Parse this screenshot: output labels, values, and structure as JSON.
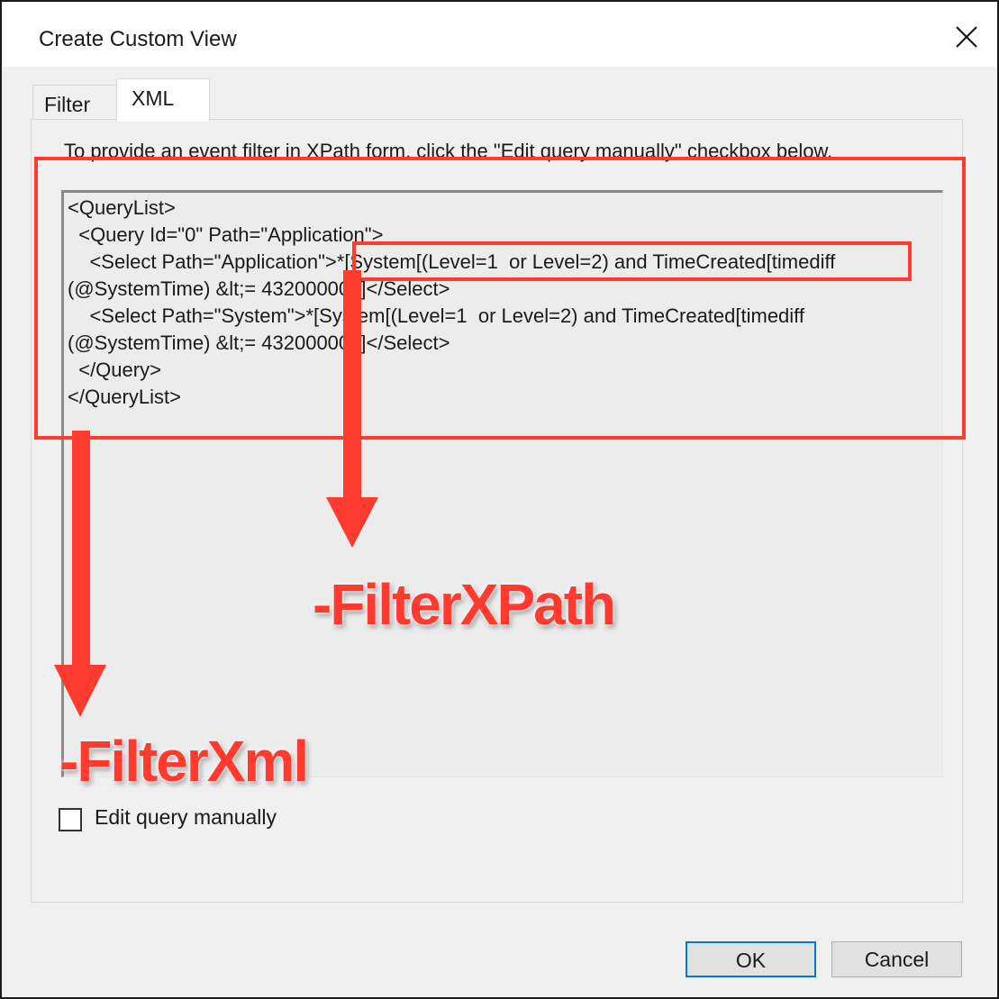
{
  "window": {
    "title": "Create Custom View",
    "close_icon": "close-icon"
  },
  "tabs": [
    {
      "label": "Filter",
      "selected": false
    },
    {
      "label": "XML",
      "selected": true
    }
  ],
  "xml_tab": {
    "hint": "To provide an event filter in XPath form, click the \"Edit query manually\" checkbox below.",
    "lines": [
      "<QueryList>",
      "  <Query Id=\"0\" Path=\"Application\">",
      "    <Select Path=\"Application\">*[System[(Level=1  or Level=2) and TimeCreated[timediff",
      "(@SystemTime) &lt;= 43200000]]]</Select>",
      "    <Select Path=\"System\">*[System[(Level=1  or Level=2) and TimeCreated[timediff",
      "(@SystemTime) &lt;= 43200000]]]</Select>",
      "  </Query>",
      "</QueryList>"
    ],
    "edit_manually_label": "Edit query manually",
    "edit_manually_checked": false
  },
  "buttons": {
    "ok": "OK",
    "cancel": "Cancel"
  },
  "annotations": {
    "filter_xpath": "-FilterXPath",
    "filter_xml": "-FilterXml",
    "color": "#ff3b30"
  },
  "colors": {
    "dialog_bg": "#f0f0f0",
    "accent_border": "#0078d7"
  }
}
